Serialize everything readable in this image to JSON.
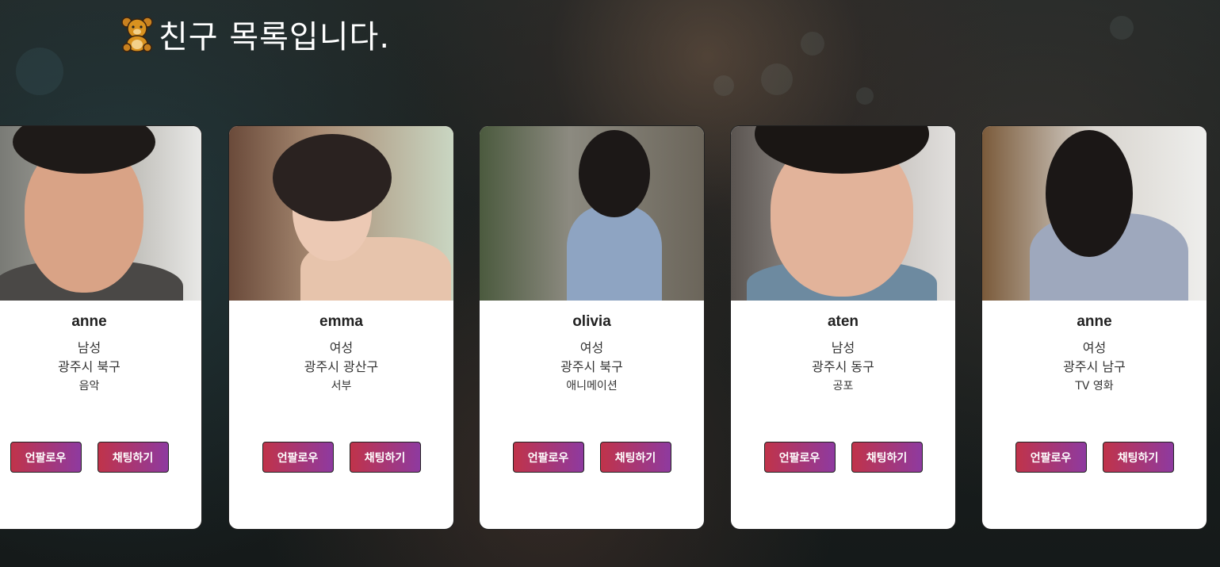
{
  "header": {
    "title": "친구 목록입니다.",
    "icon": "teddy-bear-icon"
  },
  "friends": [
    {
      "name": "anne",
      "gender": "남성",
      "region": "광주시 북구",
      "hobby": "음악",
      "unfollow_label": "언팔로우",
      "chat_label": "채팅하기"
    },
    {
      "name": "emma",
      "gender": "여성",
      "region": "광주시 광산구",
      "hobby": "서부",
      "unfollow_label": "언팔로우",
      "chat_label": "채팅하기"
    },
    {
      "name": "olivia",
      "gender": "여성",
      "region": "광주시 북구",
      "hobby": "애니메이션",
      "unfollow_label": "언팔로우",
      "chat_label": "채팅하기"
    },
    {
      "name": "aten",
      "gender": "남성",
      "region": "광주시 동구",
      "hobby": "공포",
      "unfollow_label": "언팔로우",
      "chat_label": "채팅하기"
    },
    {
      "name": "anne",
      "gender": "여성",
      "region": "광주시 남구",
      "hobby": "TV 영화",
      "unfollow_label": "언팔로우",
      "chat_label": "채팅하기"
    }
  ],
  "colors": {
    "button_gradient_start": "#c0334a",
    "button_gradient_end": "#8e3aa0",
    "card_background": "#ffffff"
  }
}
